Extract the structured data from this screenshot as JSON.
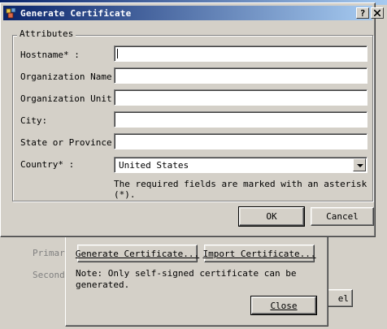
{
  "background": {
    "labels": [
      "Primary",
      "Seconda"
    ],
    "partial_button": "el"
  },
  "certificate_panel": {
    "generate_button": "Generate Certificate...",
    "import_button": "Import Certificate...",
    "note": "Note: Only self-signed certificate can be generated.",
    "close_button": "Close"
  },
  "dialog": {
    "title": "Generate Certificate",
    "help_button": "?",
    "close_button": "X",
    "group_title": "Attributes",
    "fields": [
      {
        "label": "Hostname* :",
        "value": ""
      },
      {
        "label": "Organization Name:",
        "value": ""
      },
      {
        "label": "Organization Unit:",
        "value": ""
      },
      {
        "label": "City:",
        "value": ""
      },
      {
        "label": "State or Province:",
        "value": ""
      }
    ],
    "country": {
      "label": "Country* :",
      "value": "United States"
    },
    "required_note": "The required fields are marked with an asterisk (*).",
    "ok_button": "OK",
    "cancel_button": "Cancel"
  },
  "colors": {
    "title_gradient_start": "#0a246a",
    "title_gradient_end": "#a6caf0",
    "face": "#d4d0c8"
  }
}
